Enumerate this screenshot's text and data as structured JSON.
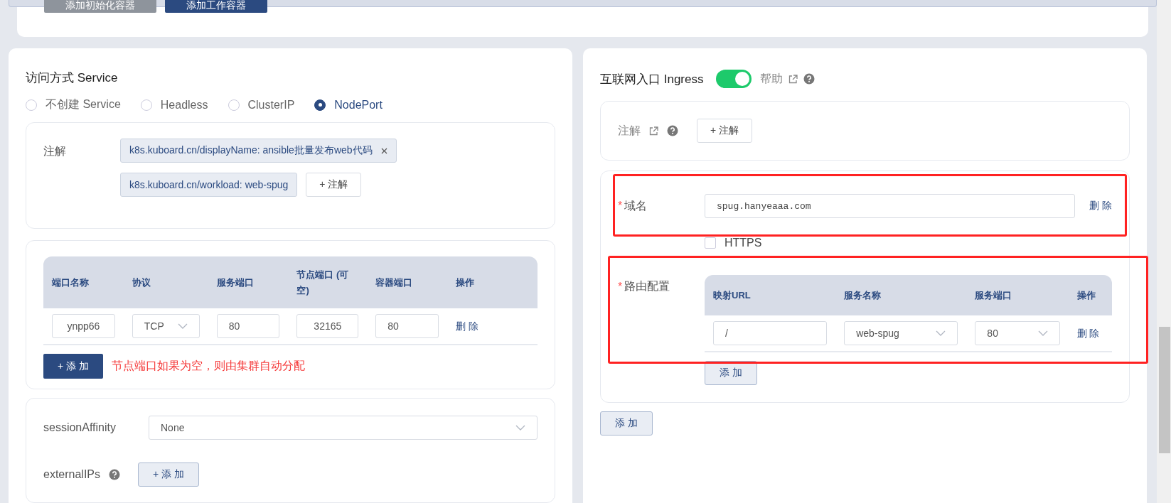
{
  "top_buttons": [
    {
      "label": "添加初始化容器",
      "kind": "secondary"
    },
    {
      "label": "添加工作容器",
      "kind": "primary"
    }
  ],
  "service": {
    "title": "访问方式 Service",
    "options": [
      {
        "label": "不创建 Service",
        "selected": false
      },
      {
        "label": "Headless",
        "selected": false
      },
      {
        "label": "ClusterIP",
        "selected": false
      },
      {
        "label": "NodePort",
        "selected": true
      }
    ],
    "annotations": {
      "label": "注解",
      "tags": [
        {
          "text": "k8s.kuboard.cn/displayName: ansible批量发布web代码",
          "closable": true
        },
        {
          "text": "k8s.kuboard.cn/workload: web-spug",
          "closable": false
        }
      ],
      "add_button": "+ 注解"
    },
    "ports": {
      "columns": [
        "端口名称",
        "协议",
        "服务端口",
        "节点端口 (可空)",
        "容器端口",
        "操作"
      ],
      "rows": [
        {
          "name": "ynpp66",
          "protocol": "TCP",
          "service_port": "80",
          "node_port": "32165",
          "container_port": "80",
          "action": "删 除"
        }
      ],
      "add_button": "+ 添 加",
      "hint": "节点端口如果为空，则由集群自动分配"
    },
    "session_affinity": {
      "label": "sessionAffinity",
      "value": "None"
    },
    "external_ips": {
      "label": "externalIPs",
      "add_button": "+ 添 加"
    }
  },
  "ingress": {
    "title": "互联网入口 Ingress",
    "on": true,
    "help": "帮助",
    "annotations": {
      "label": "注解",
      "add_button": "+ 注解"
    },
    "rules": [
      {
        "domain_required_mark": "*",
        "domain_label": "域名",
        "domain": "spug.hanyeaaa.com",
        "delete": "删 除",
        "https_label": "HTTPS",
        "https": false,
        "routes_required_mark": "*",
        "routes_label": "路由配置",
        "columns": [
          "映射URL",
          "服务名称",
          "服务端口",
          "操作"
        ],
        "routes": [
          {
            "url": "/",
            "service": "web-spug",
            "port": "80",
            "action": "删 除"
          }
        ],
        "add_button": "添 加"
      }
    ],
    "add_button": "添 加"
  }
}
